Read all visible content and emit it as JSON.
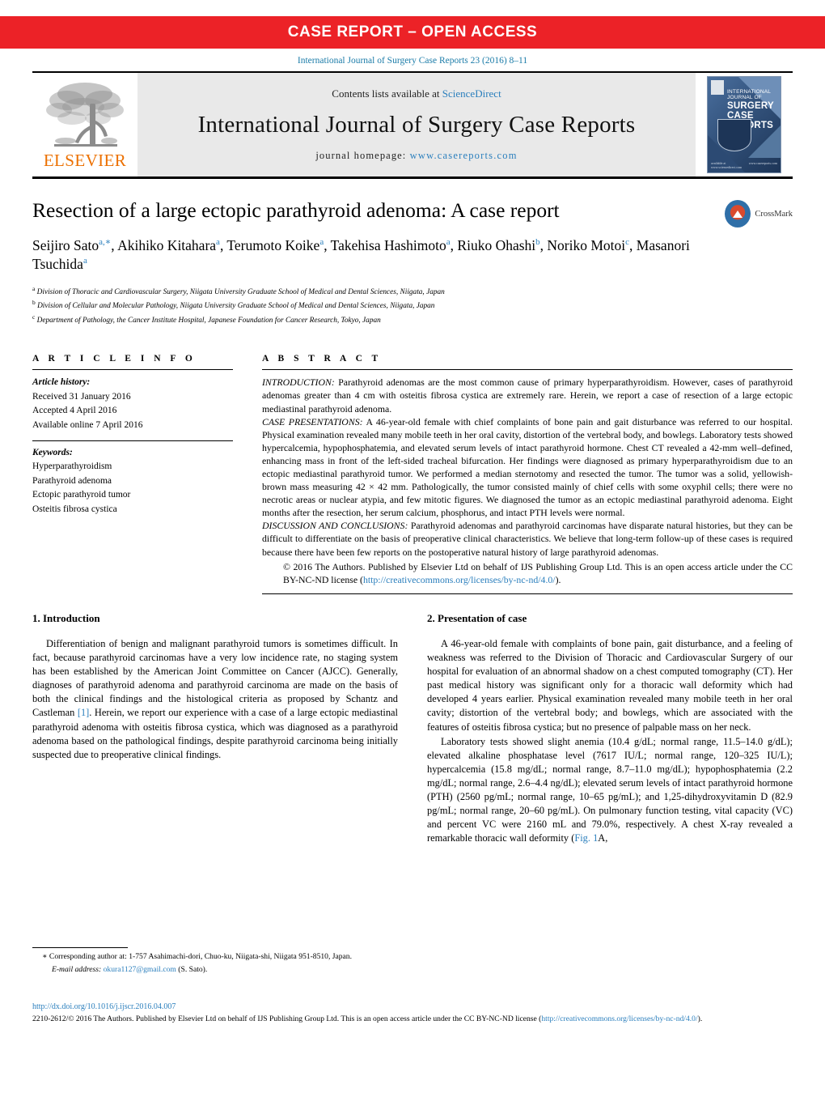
{
  "banner": {
    "label": "CASE REPORT – OPEN ACCESS",
    "color": "#ec2227"
  },
  "citation": "International Journal of Surgery Case Reports 23 (2016) 8–11",
  "masthead": {
    "publisher_name": "ELSEVIER",
    "contents_prefix": "Contents lists available at ",
    "contents_link": "ScienceDirect",
    "journal_title": "International Journal of Surgery Case Reports",
    "homepage_prefix": "journal homepage: ",
    "homepage_url": "www.casereports.com",
    "cover": {
      "line1": "INTERNATIONAL",
      "line2": "JOURNAL OF",
      "line3": "SURGERY",
      "line4": "CASE",
      "line5": "REPORTS",
      "subtitle": "Official Journal of Surgical Associates Ltd",
      "foot_left": "available at www.sciencedirect.com",
      "foot_right": "www.casereports.com"
    }
  },
  "article": {
    "title": "Resection of a large ectopic parathyroid adenoma: A case report",
    "crossmark_label": "CrossMark",
    "authors": [
      {
        "name": "Seijiro Sato",
        "sup": "a,∗"
      },
      {
        "name": "Akihiko Kitahara",
        "sup": "a"
      },
      {
        "name": "Terumoto Koike",
        "sup": "a"
      },
      {
        "name": "Takehisa Hashimoto",
        "sup": "a"
      },
      {
        "name": "Riuko Ohashi",
        "sup": "b"
      },
      {
        "name": "Noriko Motoi",
        "sup": "c"
      },
      {
        "name": "Masanori Tsuchida",
        "sup": "a"
      }
    ],
    "affiliations": [
      {
        "marker": "a",
        "text": "Division of Thoracic and Cardiovascular Surgery, Niigata University Graduate School of Medical and Dental Sciences, Niigata, Japan"
      },
      {
        "marker": "b",
        "text": "Division of Cellular and Molecular Pathology, Niigata University Graduate School of Medical and Dental Sciences, Niigata, Japan"
      },
      {
        "marker": "c",
        "text": "Department of Pathology, the Cancer Institute Hospital, Japanese Foundation for Cancer Research, Tokyo, Japan"
      }
    ]
  },
  "article_info": {
    "heading": "A R T I C L E   I N F O",
    "history_label": "Article history:",
    "history": [
      "Received 31 January 2016",
      "Accepted 4 April 2016",
      "Available online 7 April 2016"
    ],
    "keywords_label": "Keywords:",
    "keywords": [
      "Hyperparathyroidism",
      "Parathyroid adenoma",
      "Ectopic parathyroid tumor",
      "Osteitis fibrosa cystica"
    ]
  },
  "abstract": {
    "heading": "A B S T R A C T",
    "introduction_label": "INTRODUCTION:",
    "introduction_text": " Parathyroid adenomas are the most common cause of primary hyperparathyroidism. However, cases of parathyroid adenomas greater than 4 cm with osteitis fibrosa cystica are extremely rare. Herein, we report a case of resection of a large ectopic mediastinal parathyroid adenoma.",
    "case_label": "CASE PRESENTATIONS:",
    "case_text": " A 46-year-old female with chief complaints of bone pain and gait disturbance was referred to our hospital. Physical examination revealed many mobile teeth in her oral cavity, distortion of the vertebral body, and bowlegs. Laboratory tests showed hypercalcemia, hypophosphatemia, and elevated serum levels of intact parathyroid hormone. Chest CT revealed a 42-mm well–defined, enhancing mass in front of the left-sided tracheal bifurcation. Her findings were diagnosed as primary hyperparathyroidism due to an ectopic mediastinal parathyroid tumor. We performed a median sternotomy and resected the tumor. The tumor was a solid, yellowish-brown mass measuring 42 × 42 mm. Pathologically, the tumor consisted mainly of chief cells with some oxyphil cells; there were no necrotic areas or nuclear atypia, and few mitotic figures. We diagnosed the tumor as an ectopic mediastinal parathyroid adenoma. Eight months after the resection, her serum calcium, phosphorus, and intact PTH levels were normal.",
    "discussion_label": "DISCUSSION AND CONCLUSIONS:",
    "discussion_text": " Parathyroid adenomas and parathyroid carcinomas have disparate natural histories, but they can be difficult to differentiate on the basis of preoperative clinical characteristics. We believe that long-term follow-up of these cases is required because there have been few reports on the postoperative natural history of large parathyroid adenomas.",
    "copyright_text": "© 2016 The Authors. Published by Elsevier Ltd on behalf of IJS Publishing Group Ltd. This is an open access article under the CC BY-NC-ND license (",
    "copyright_link": "http://creativecommons.org/licenses/by-nc-nd/4.0/",
    "copyright_tail": ")."
  },
  "sections": {
    "intro": {
      "heading": "1.  Introduction",
      "para_a": "Differentiation of benign and malignant parathyroid tumors is sometimes difficult. In fact, because parathyroid carcinomas have a very low incidence rate, no staging system has been established by the American Joint Committee on Cancer (AJCC). Generally, diagnoses of parathyroid adenoma and parathyroid carcinoma are made on the basis of both the clinical findings and the histological criteria as proposed by Schantz and Castleman ",
      "ref": "[1]",
      "para_b": ". Herein, we report our experience with a case of a large ectopic mediastinal parathyroid adenoma with osteitis fibrosa cystica, which was diagnosed as a parathyroid adenoma based on the pathological findings, despite parathyroid carcinoma being initially suspected due to preoperative clinical findings."
    },
    "case": {
      "heading": "2.  Presentation of case",
      "para1": "A 46-year-old female with complaints of bone pain, gait disturbance, and a feeling of weakness was referred to the Division of Thoracic and Cardiovascular Surgery of our hospital for evaluation of an abnormal shadow on a chest computed tomography (CT). Her past medical history was significant only for a thoracic wall deformity which had developed 4 years earlier. Physical examination revealed many mobile teeth in her oral cavity; distortion of the vertebral body; and bowlegs, which are associated with the features of osteitis fibrosa cystica; but no presence of palpable mass on her neck.",
      "para2_a": "Laboratory tests showed slight anemia (10.4 g/dL; normal range, 11.5–14.0 g/dL); elevated alkaline phosphatase level (7617 IU/L; normal range, 120–325 IU/L); hypercalcemia (15.8 mg/dL; normal range, 8.7–11.0 mg/dL); hypophosphatemia (2.2 mg/dL; normal range, 2.6–4.4 ng/dL); elevated serum levels of intact parathyroid hormone (PTH) (2560 pg/mL; normal range, 10–65 pg/mL); and 1,25-dihydroxyvitamin D (82.9 pg/mL; normal range, 20–60 pg/mL). On pulmonary function testing, vital capacity (VC) and percent VC were 2160 mL and 79.0%, respectively. A chest X-ray revealed a remarkable thoracic wall deformity (",
      "figref": "Fig. 1",
      "para2_b": "A,"
    }
  },
  "footnote": {
    "corresponding": "∗ Corresponding author at: 1-757 Asahimachi-dori, Chuo-ku, Niigata-shi, Niigata 951-8510, Japan.",
    "email_label": "E-mail address:",
    "email": "okura1127@gmail.com",
    "email_owner": "(S. Sato)."
  },
  "bottom": {
    "doi": "http://dx.doi.org/10.1016/j.ijscr.2016.04.007",
    "issn_copy": "2210-2612/© 2016 The Authors. Published by Elsevier Ltd on behalf of IJS Publishing Group Ltd. This is an open access article under the CC BY-NC-ND license (",
    "license_link": "http://creativecommons.org/licenses/by-nc-nd/4.0/",
    "tail": ")."
  }
}
